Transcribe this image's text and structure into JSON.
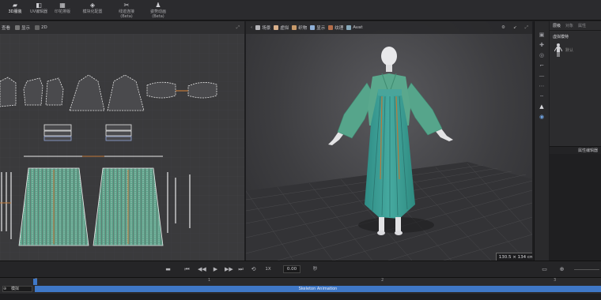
{
  "topbar": {
    "modes": [
      {
        "icon": "folder-icon",
        "label": "3D服装",
        "active": true
      },
      {
        "icon": "avatar-icon",
        "label": "UV编辑器",
        "active": false
      },
      {
        "icon": "print-icon",
        "label": "印花排版",
        "active": false
      },
      {
        "icon": "fabric-icon",
        "label": "模块化配置",
        "active": false
      },
      {
        "icon": "sewing-icon",
        "label": "线迹连接",
        "sub": "(Beta)",
        "active": false
      },
      {
        "icon": "pose-icon",
        "label": "姿势动画",
        "sub": "(Beta)",
        "active": false
      }
    ]
  },
  "panel2d": {
    "toolbar": [
      {
        "label": "查看"
      },
      {
        "label": "显示"
      },
      {
        "label": "2D"
      }
    ]
  },
  "panel3d": {
    "toolbar": [
      {
        "label": "场景",
        "color": "#b4b4b8"
      },
      {
        "label": "虚拟",
        "color": "#d9b08c"
      },
      {
        "label": "织物",
        "color": "#c89a6a"
      },
      {
        "label": "显示",
        "color": "#8fb0d8"
      },
      {
        "label": "纹理",
        "color": "#b46d4a"
      },
      {
        "label": "Avat",
        "color": "#8ab"
      }
    ],
    "label_box": "130.5 × 134 cm"
  },
  "sidepanel": {
    "tabs": [
      "层级",
      "对象",
      "属性"
    ],
    "title": "虚拟模特",
    "child": "默认"
  },
  "timeline": {
    "speed": "1X",
    "time": "0.00",
    "frame": "秒",
    "ruler": [
      "0",
      "1",
      "2",
      "3"
    ],
    "track_label": "模拟",
    "track_bar": "Skeleton Animation"
  },
  "colors": {
    "accent": "#3f78c7",
    "garment_teal": "#3aa097",
    "garment_green": "#5ba388",
    "stripe_orange": "#b8793a"
  }
}
